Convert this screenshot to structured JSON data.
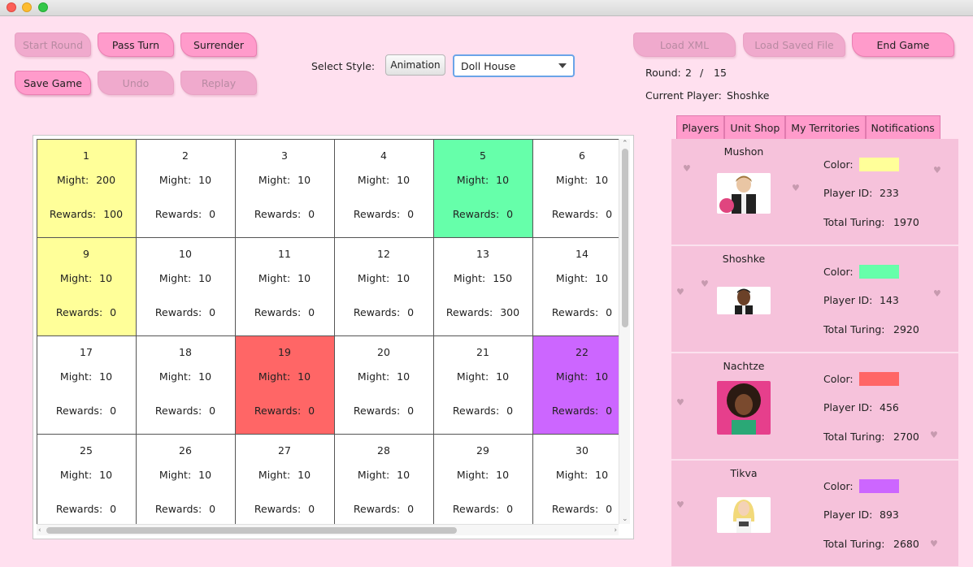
{
  "toolbar": {
    "start_round": "Start Round",
    "pass_turn": "Pass Turn",
    "surrender": "Surrender",
    "save_game": "Save Game",
    "undo": "Undo",
    "replay": "Replay",
    "select_style_label": "Select Style:",
    "animation": "Animation",
    "style_value": "Doll House",
    "load_xml": "Load XML",
    "load_saved_file": "Load Saved File",
    "end_game": "End Game"
  },
  "status": {
    "round_label": "Round:",
    "round_current": "2",
    "round_sep": "/",
    "round_total": "15",
    "current_player_label": "Current Player:",
    "current_player": "Shoshke"
  },
  "board": {
    "might_label": "Might:",
    "rewards_label": "Rewards:",
    "cells": [
      {
        "id": "1",
        "might": "200",
        "rewards": "100",
        "color": "#ffff99"
      },
      {
        "id": "2",
        "might": "10",
        "rewards": "0",
        "color": "#ffffff"
      },
      {
        "id": "3",
        "might": "10",
        "rewards": "0",
        "color": "#ffffff"
      },
      {
        "id": "4",
        "might": "10",
        "rewards": "0",
        "color": "#ffffff"
      },
      {
        "id": "5",
        "might": "10",
        "rewards": "0",
        "color": "#66ffaa"
      },
      {
        "id": "6",
        "might": "10",
        "rewards": "0",
        "color": "#ffffff"
      },
      {
        "id": "9",
        "might": "10",
        "rewards": "0",
        "color": "#ffff99"
      },
      {
        "id": "10",
        "might": "10",
        "rewards": "0",
        "color": "#ffffff"
      },
      {
        "id": "11",
        "might": "10",
        "rewards": "0",
        "color": "#ffffff"
      },
      {
        "id": "12",
        "might": "10",
        "rewards": "0",
        "color": "#ffffff"
      },
      {
        "id": "13",
        "might": "150",
        "rewards": "300",
        "color": "#ffffff"
      },
      {
        "id": "14",
        "might": "10",
        "rewards": "0",
        "color": "#ffffff"
      },
      {
        "id": "17",
        "might": "10",
        "rewards": "0",
        "color": "#ffffff"
      },
      {
        "id": "18",
        "might": "10",
        "rewards": "0",
        "color": "#ffffff"
      },
      {
        "id": "19",
        "might": "10",
        "rewards": "0",
        "color": "#ff6666"
      },
      {
        "id": "20",
        "might": "10",
        "rewards": "0",
        "color": "#ffffff"
      },
      {
        "id": "21",
        "might": "10",
        "rewards": "0",
        "color": "#ffffff"
      },
      {
        "id": "22",
        "might": "10",
        "rewards": "0",
        "color": "#cc66ff"
      },
      {
        "id": "25",
        "might": "10",
        "rewards": "0",
        "color": "#ffffff"
      },
      {
        "id": "26",
        "might": "10",
        "rewards": "0",
        "color": "#ffffff"
      },
      {
        "id": "27",
        "might": "10",
        "rewards": "0",
        "color": "#ffffff"
      },
      {
        "id": "28",
        "might": "10",
        "rewards": "0",
        "color": "#ffffff"
      },
      {
        "id": "29",
        "might": "10",
        "rewards": "0",
        "color": "#ffffff"
      },
      {
        "id": "30",
        "might": "10",
        "rewards": "0",
        "color": "#ffffff"
      }
    ]
  },
  "tabs": [
    "Players",
    "Unit Shop",
    "My Territories",
    "Notifications"
  ],
  "players": {
    "color_label": "Color:",
    "id_label": "Player ID:",
    "turing_label": "Total Turing:",
    "list": [
      {
        "name": "Mushon",
        "color": "#ffff99",
        "id": "233",
        "turing": "1970"
      },
      {
        "name": "Shoshke",
        "color": "#66ffaa",
        "id": "143",
        "turing": "2920"
      },
      {
        "name": "Nachtze",
        "color": "#ff6666",
        "id": "456",
        "turing": "2700"
      },
      {
        "name": "Tikva",
        "color": "#cc66ff",
        "id": "893",
        "turing": "2680"
      }
    ]
  },
  "icons": {
    "avatar_icon": "doll-avatar",
    "scroll_up": "arrow-up-icon",
    "scroll_down": "arrow-down-icon",
    "scroll_left": "arrow-left-icon",
    "scroll_right": "arrow-right-icon"
  }
}
